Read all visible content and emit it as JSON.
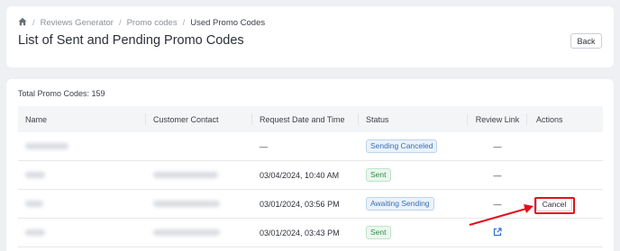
{
  "breadcrumb": {
    "items": [
      "Reviews Generator",
      "Promo codes",
      "Used Promo Codes"
    ],
    "separator": "/"
  },
  "header": {
    "title": "List of Sent and Pending Promo Codes",
    "back_label": "Back"
  },
  "summary": {
    "total_label": "Total Promo Codes: 159"
  },
  "table": {
    "columns": [
      "Name",
      "Customer Contact",
      "Request Date and Time",
      "Status",
      "Review Link",
      "Actions"
    ],
    "rows": [
      {
        "date": "—",
        "status": "Sending Canceled",
        "review_link": "—"
      },
      {
        "date": "03/04/2024, 10:40 AM",
        "status": "Sent",
        "review_link": "—"
      },
      {
        "date": "03/01/2024, 03:56 PM",
        "status": "Awaiting Sending",
        "review_link": "—",
        "action": "Cancel"
      },
      {
        "date": "03/01/2024, 03:43 PM",
        "status": "Sent",
        "review_link_icon": "external-link-icon"
      }
    ]
  },
  "colors": {
    "background": "#eef0f3",
    "annotation_red": "#e3101b",
    "badge_blue": "#3d6fb0",
    "badge_green": "#2f8a4a",
    "link_blue": "#2f6fd1"
  }
}
